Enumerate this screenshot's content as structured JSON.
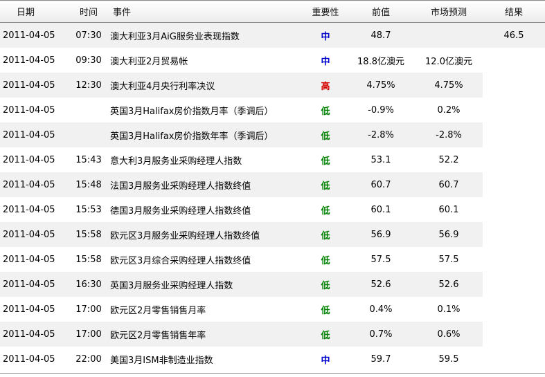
{
  "columns": {
    "date": "日期",
    "time": "时间",
    "event": "事件",
    "importance": "重要性",
    "previous": "前值",
    "forecast": "市场预测",
    "result": "结果"
  },
  "colors": {
    "high": "#d40000",
    "medium": "#0000cc",
    "low": "#008000"
  },
  "rows": [
    {
      "date": "2011-04-05",
      "time": "07:30",
      "event": "澳大利亚3月AiG服务业表现指数",
      "importance": "中",
      "level": "medium",
      "previous": "48.7",
      "forecast": "",
      "result": "46.5"
    },
    {
      "date": "2011-04-05",
      "time": "09:30",
      "event": "澳大利亚2月贸易帐",
      "importance": "中",
      "level": "medium",
      "previous": "18.8亿澳元",
      "forecast": "12.0亿澳元",
      "result": ""
    },
    {
      "date": "2011-04-05",
      "time": "12:30",
      "event": "澳大利亚4月央行利率决议",
      "importance": "高",
      "level": "high",
      "previous": "4.75%",
      "forecast": "4.75%",
      "result": ""
    },
    {
      "date": "2011-04-05",
      "time": "",
      "event": "英国3月Halifax房价指数月率（季调后）",
      "importance": "低",
      "level": "low",
      "previous": "-0.9%",
      "forecast": "0.2%",
      "result": ""
    },
    {
      "date": "2011-04-05",
      "time": "",
      "event": "英国3月Halifax房价指数年率（季调后）",
      "importance": "低",
      "level": "low",
      "previous": "-2.8%",
      "forecast": "-2.8%",
      "result": ""
    },
    {
      "date": "2011-04-05",
      "time": "15:43",
      "event": "意大利3月服务业采购经理人指数",
      "importance": "低",
      "level": "low",
      "previous": "53.1",
      "forecast": "52.2",
      "result": ""
    },
    {
      "date": "2011-04-05",
      "time": "15:48",
      "event": "法国3月服务业采购经理人指数终值",
      "importance": "低",
      "level": "low",
      "previous": "60.7",
      "forecast": "60.7",
      "result": ""
    },
    {
      "date": "2011-04-05",
      "time": "15:53",
      "event": "德国3月服务业采购经理人指数终值",
      "importance": "低",
      "level": "low",
      "previous": "60.1",
      "forecast": "60.1",
      "result": ""
    },
    {
      "date": "2011-04-05",
      "time": "15:58",
      "event": "欧元区3月服务业采购经理人指数终值",
      "importance": "低",
      "level": "low",
      "previous": "56.9",
      "forecast": "56.9",
      "result": ""
    },
    {
      "date": "2011-04-05",
      "time": "15:58",
      "event": "欧元区3月综合采购经理人指数终值",
      "importance": "低",
      "level": "low",
      "previous": "57.5",
      "forecast": "57.5",
      "result": ""
    },
    {
      "date": "2011-04-05",
      "time": "16:30",
      "event": "英国3月服务业采购经理人指数",
      "importance": "低",
      "level": "low",
      "previous": "52.6",
      "forecast": "52.6",
      "result": ""
    },
    {
      "date": "2011-04-05",
      "time": "17:00",
      "event": "欧元区2月零售销售月率",
      "importance": "低",
      "level": "low",
      "previous": "0.4%",
      "forecast": "0.1%",
      "result": ""
    },
    {
      "date": "2011-04-05",
      "time": "17:00",
      "event": "欧元区2月零售销售年率",
      "importance": "低",
      "level": "low",
      "previous": "0.7%",
      "forecast": "0.6%",
      "result": ""
    },
    {
      "date": "2011-04-05",
      "time": "22:00",
      "event": "美国3月ISM非制造业指数",
      "importance": "中",
      "level": "medium",
      "previous": "59.7",
      "forecast": "59.5",
      "result": ""
    }
  ]
}
